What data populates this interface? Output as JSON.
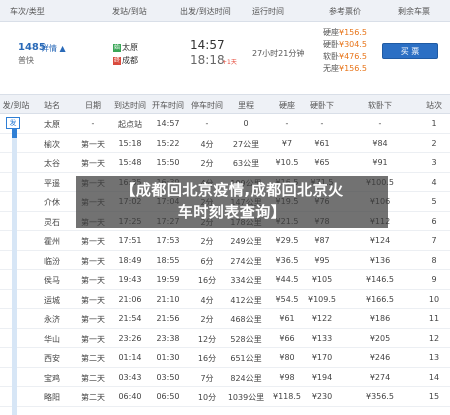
{
  "summary": {
    "headers": [
      "车次/类型",
      "发站/到站",
      "出发/到达时间",
      "运行时间",
      "参考票价",
      "剩余车票"
    ],
    "train_no": "1485",
    "detail_link": "详情",
    "detail_arrow": "▲",
    "train_type": "普快",
    "from_tag": "始",
    "from_station": "太原",
    "to_tag": "终",
    "to_station": "成都",
    "depart_time": "14:57",
    "arrive_time": "18:18",
    "plus_days": "+1天",
    "duration": "27小时21分钟",
    "prices": [
      {
        "label": "硬座",
        "value": "¥156.5"
      },
      {
        "label": "硬卧",
        "value": "¥304.5"
      },
      {
        "label": "软卧",
        "value": "¥476.5"
      },
      {
        "label": "无座",
        "value": "¥156.5"
      }
    ],
    "buy_label": "买 票"
  },
  "timetable": {
    "headers": [
      "发/到站",
      "站名",
      "日期",
      "到达时间",
      "开车时间",
      "停车时间",
      "里程",
      "硬座",
      "硬卧下",
      "软卧下",
      "站次"
    ],
    "progress_label": "发",
    "progress_fraction": 0.04,
    "rows": [
      [
        "太原",
        "-",
        "起点站",
        "14:57",
        "-",
        "0",
        "-",
        "-",
        "-",
        "1"
      ],
      [
        "榆次",
        "第一天",
        "15:18",
        "15:22",
        "4分",
        "27公里",
        "¥7",
        "¥61",
        "¥84",
        "2"
      ],
      [
        "太谷",
        "第一天",
        "15:48",
        "15:50",
        "2分",
        "63公里",
        "¥10.5",
        "¥65",
        "¥91",
        "3"
      ],
      [
        "平遥",
        "第一天",
        "16:35",
        "16:39",
        "4分",
        "109公里",
        "¥16.5",
        "¥71.5",
        "¥100.5",
        "4"
      ],
      [
        "介休",
        "第一天",
        "17:02",
        "17:04",
        "2分",
        "147公里",
        "¥19.5",
        "¥76",
        "¥106",
        "5"
      ],
      [
        "灵石",
        "第一天",
        "17:25",
        "17:27",
        "2分",
        "178公里",
        "¥21.5",
        "¥78",
        "¥112",
        "6"
      ],
      [
        "霍州",
        "第一天",
        "17:51",
        "17:53",
        "2分",
        "249公里",
        "¥29.5",
        "¥87",
        "¥124",
        "7"
      ],
      [
        "临汾",
        "第一天",
        "18:49",
        "18:55",
        "6分",
        "274公里",
        "¥36.5",
        "¥95",
        "¥136",
        "8"
      ],
      [
        "侯马",
        "第一天",
        "19:43",
        "19:59",
        "16分",
        "334公里",
        "¥44.5",
        "¥105",
        "¥146.5",
        "9"
      ],
      [
        "运城",
        "第一天",
        "21:06",
        "21:10",
        "4分",
        "412公里",
        "¥54.5",
        "¥109.5",
        "¥166.5",
        "10"
      ],
      [
        "永济",
        "第一天",
        "21:54",
        "21:56",
        "2分",
        "468公里",
        "¥61",
        "¥122",
        "¥186",
        "11"
      ],
      [
        "华山",
        "第一天",
        "23:26",
        "23:38",
        "12分",
        "528公里",
        "¥66",
        "¥133",
        "¥205",
        "12"
      ],
      [
        "西安",
        "第二天",
        "01:14",
        "01:30",
        "16分",
        "651公里",
        "¥80",
        "¥170",
        "¥246",
        "13"
      ],
      [
        "宝鸡",
        "第二天",
        "03:43",
        "03:50",
        "7分",
        "824公里",
        "¥98",
        "¥194",
        "¥274",
        "14"
      ],
      [
        "略阳",
        "第二天",
        "06:40",
        "06:50",
        "10分",
        "1039公里",
        "¥118.5",
        "¥230",
        "¥356.5",
        "15"
      ]
    ]
  },
  "overlay": {
    "line1": "【成都回北京疫情,成都回北京火",
    "line2": "车时刻表查询】"
  }
}
